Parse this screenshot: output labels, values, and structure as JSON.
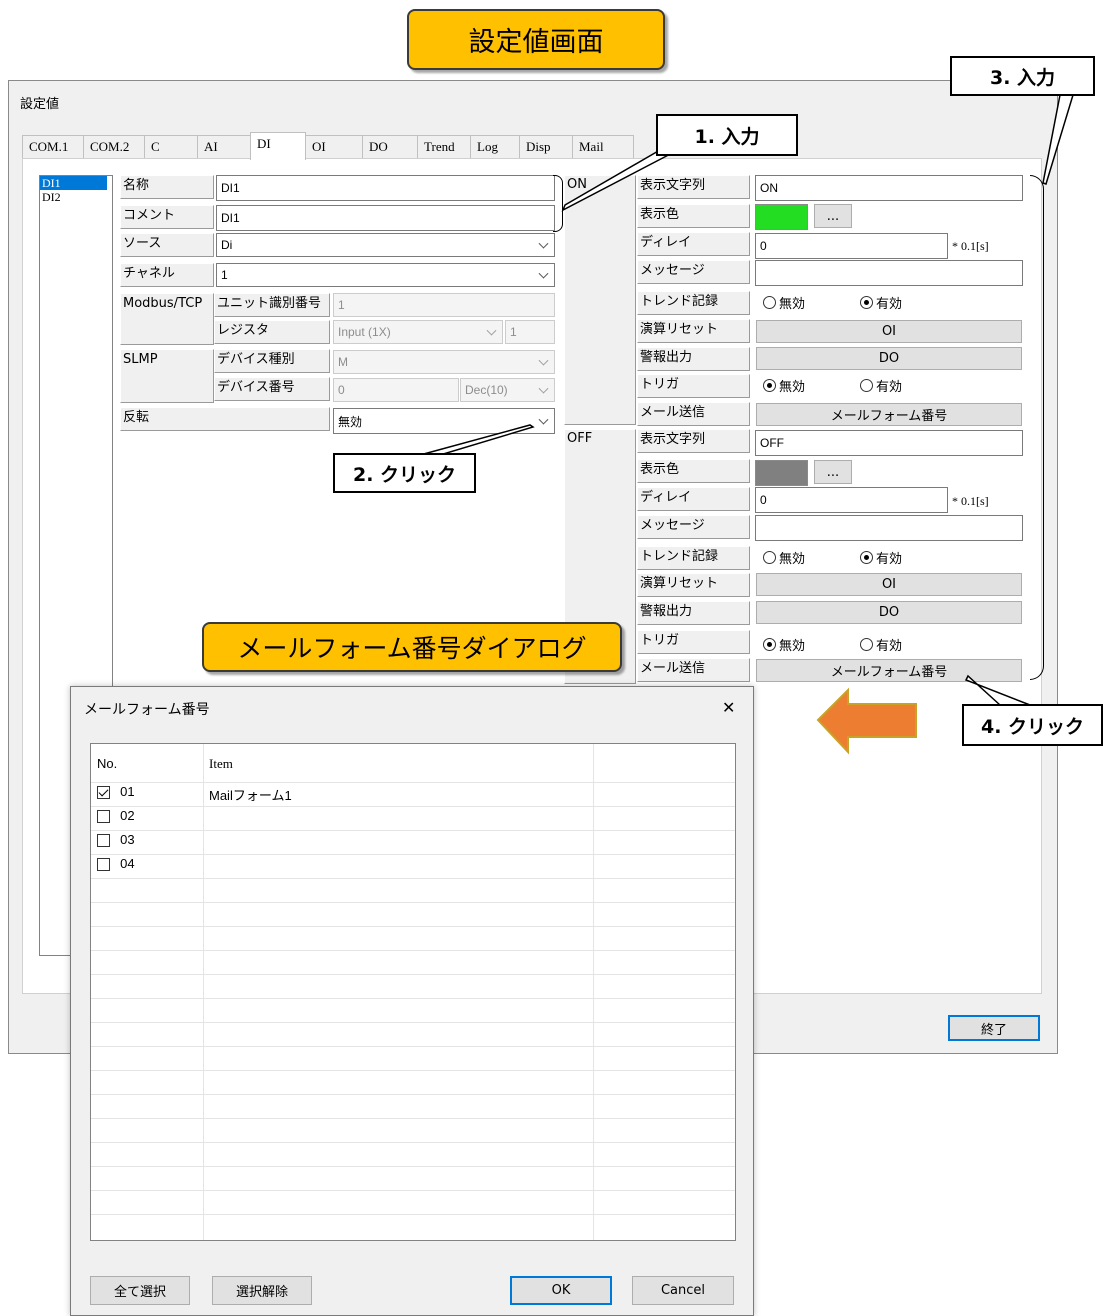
{
  "callouts": {
    "title": "設定値画面",
    "step1": "1. 入力",
    "step2": "2. クリック",
    "step3": "3. 入力",
    "step4": "4. クリック",
    "mail_dialog": "メールフォーム番号ダイアログ"
  },
  "window": {
    "title": "設定値",
    "tabs": [
      "COM.1",
      "COM.2",
      "C",
      "AI",
      "DI",
      "OI",
      "DO",
      "Trend",
      "Log",
      "Disp",
      "Mail"
    ],
    "active_tab": "DI",
    "list": [
      "DI1",
      "DI2"
    ],
    "selected": "DI1",
    "close_button": "終了"
  },
  "form": {
    "name_label": "名称",
    "name_value": "DI1",
    "comment_label": "コメント",
    "comment_value": "DI1",
    "source_label": "ソース",
    "source_value": "Di",
    "channel_label": "チャネル",
    "channel_value": "1",
    "modbus_label": "Modbus/TCP",
    "unit_id_label": "ユニット識別番号",
    "unit_id_value": "1",
    "register_label": "レジスタ",
    "register_value": "Input (1X)",
    "register_num": "1",
    "slmp_label": "SLMP",
    "device_type_label": "デバイス種別",
    "device_type_value": "M",
    "device_no_label": "デバイス番号",
    "device_no_value": "0",
    "device_no_fmt": "Dec(10)",
    "invert_label": "反転",
    "invert_value": "無効"
  },
  "on_section": {
    "header": "ON",
    "text_label": "表示文字列",
    "text_value": "ON",
    "color_label": "表示色",
    "color": "#22dd22",
    "color_btn": "...",
    "delay_label": "ディレイ",
    "delay_value": "0",
    "delay_unit": "* 0.1[s]",
    "message_label": "メッセージ",
    "message_value": "",
    "trend_label": "トレンド記録",
    "trend_off": "無効",
    "trend_on": "有効",
    "reset_label": "演算リセット",
    "reset_btn": "OI",
    "alarm_label": "警報出力",
    "alarm_btn": "DO",
    "trigger_label": "トリガ",
    "trigger_off": "無効",
    "trigger_on": "有効",
    "mail_label": "メール送信",
    "mail_btn": "メールフォーム番号"
  },
  "off_section": {
    "header": "OFF",
    "text_label": "表示文字列",
    "text_value": "OFF",
    "color_label": "表示色",
    "color": "#808080",
    "color_btn": "...",
    "delay_label": "ディレイ",
    "delay_value": "0",
    "delay_unit": "* 0.1[s]",
    "message_label": "メッセージ",
    "message_value": "",
    "trend_label": "トレンド記録",
    "trend_off": "無効",
    "trend_on": "有効",
    "reset_label": "演算リセット",
    "reset_btn": "OI",
    "alarm_label": "警報出力",
    "alarm_btn": "DO",
    "trigger_label": "トリガ",
    "trigger_off": "無効",
    "trigger_on": "有効",
    "mail_label": "メール送信",
    "mail_btn": "メールフォーム番号"
  },
  "dialog": {
    "title": "メールフォーム番号",
    "close": "✕",
    "col_no": "No.",
    "col_item": "Item",
    "rows": [
      {
        "no": "01",
        "item": "Mailフォーム1",
        "checked": true
      },
      {
        "no": "02",
        "item": "",
        "checked": false
      },
      {
        "no": "03",
        "item": "",
        "checked": false
      },
      {
        "no": "04",
        "item": "",
        "checked": false
      }
    ],
    "select_all": "全て選択",
    "deselect": "選択解除",
    "ok": "OK",
    "cancel": "Cancel"
  }
}
